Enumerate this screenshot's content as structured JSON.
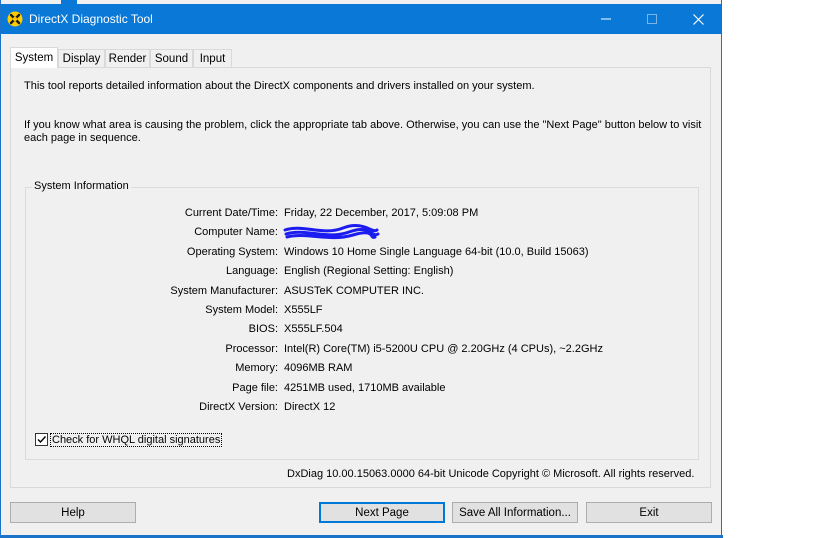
{
  "window": {
    "title": "DirectX Diagnostic Tool",
    "accent_color": "#0a78d7",
    "controls": {
      "minimize_icon": "minimize-icon",
      "maximize_icon": "maximize-icon",
      "close_icon": "close-icon"
    }
  },
  "tabs": [
    {
      "label": "System",
      "active": true
    },
    {
      "label": "Display",
      "active": false
    },
    {
      "label": "Render",
      "active": false
    },
    {
      "label": "Sound",
      "active": false
    },
    {
      "label": "Input",
      "active": false
    }
  ],
  "intro": {
    "line1": "This tool reports detailed information about the DirectX components and drivers installed on your system.",
    "line2": "If you know what area is causing the problem, click the appropriate tab above.  Otherwise, you can use the \"Next Page\" button below to visit each page in sequence."
  },
  "system_info": {
    "title": "System Information",
    "rows": [
      {
        "label": "Current Date/Time:",
        "value": "Friday, 22 December, 2017, 5:09:08 PM"
      },
      {
        "label": "Computer Name:",
        "value": ""
      },
      {
        "label": "Operating System:",
        "value": "Windows 10 Home Single Language 64-bit (10.0, Build 15063)"
      },
      {
        "label": "Language:",
        "value": "English (Regional Setting: English)"
      },
      {
        "label": "System Manufacturer:",
        "value": "ASUSTeK COMPUTER INC."
      },
      {
        "label": "System Model:",
        "value": "X555LF"
      },
      {
        "label": "BIOS:",
        "value": "X555LF.504"
      },
      {
        "label": "Processor:",
        "value": "Intel(R) Core(TM) i5-5200U CPU @ 2.20GHz (4 CPUs), ~2.2GHz"
      },
      {
        "label": "Memory:",
        "value": "4096MB RAM"
      },
      {
        "label": "Page file:",
        "value": "4251MB used, 1710MB available"
      },
      {
        "label": "DirectX Version:",
        "value": "DirectX 12"
      }
    ]
  },
  "whql_checkbox": {
    "label": "Check for WHQL digital signatures",
    "checked": true
  },
  "footer": "DxDiag 10.00.15063.0000 64-bit Unicode  Copyright © Microsoft. All rights reserved.",
  "buttons": {
    "help": "Help",
    "next_page": "Next Page",
    "save_all": "Save All Information...",
    "exit": "Exit"
  }
}
